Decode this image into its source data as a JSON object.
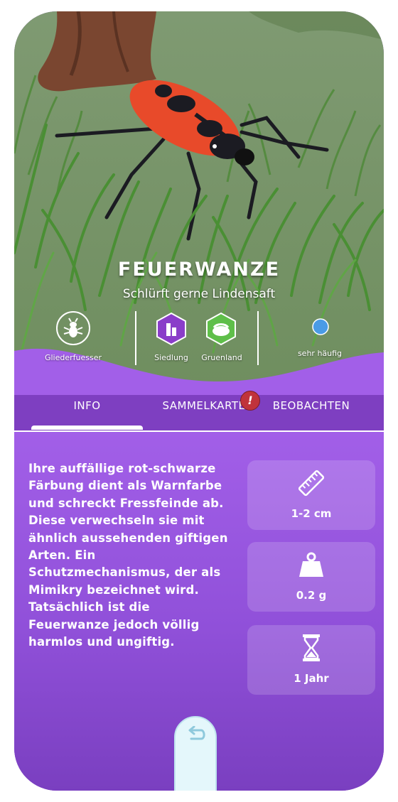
{
  "creature": {
    "name": "Feuerwanze",
    "tagline": "Schlürft gerne Lindensaft"
  },
  "meta": {
    "group_label": "Gliederfuesser",
    "group_icon": "insect-icon",
    "habitats": [
      {
        "label": "Siedlung",
        "icon": "building-hexagon-icon",
        "color": "#8a3dc9"
      },
      {
        "label": "Gruenland",
        "icon": "meadow-hexagon-icon",
        "color": "#5fbf4a"
      }
    ],
    "frequency_label": "sehr häufig",
    "frequency_color": "#4a9be6"
  },
  "tabs": [
    {
      "label": "INFO",
      "active": true
    },
    {
      "label": "SAMMELKARTE",
      "active": false,
      "badge": "!"
    },
    {
      "label": "BEOBACHTEN",
      "active": false
    }
  ],
  "info": {
    "description": "Ihre auffällige rot-schwarze Färbung dient als Warnfarbe und schreckt Fressfeinde ab. Diese verwechseln sie mit ähnlich aussehenden giftigen Arten. Ein Schutzmechanismus, der als Mimikry bezeichnet wird. Tatsächlich ist die Feuerwanze jedoch völlig harmlos und ungiftig."
  },
  "stats": [
    {
      "icon": "ruler-icon",
      "value": "1-2 cm"
    },
    {
      "icon": "weight-icon",
      "value": "0.2 g"
    },
    {
      "icon": "hourglass-icon",
      "value": "1 Jahr"
    }
  ],
  "colors": {
    "panel_purple": "#a25fe8",
    "accent_white": "#ffffff",
    "badge_red": "#c0333b"
  }
}
